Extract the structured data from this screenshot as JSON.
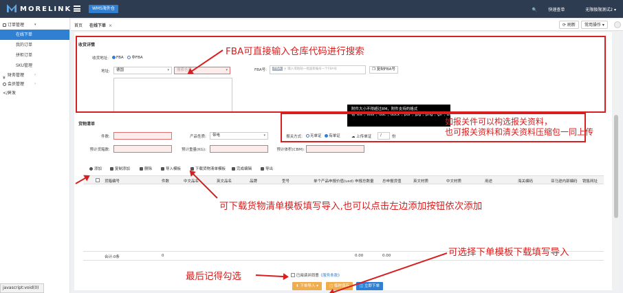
{
  "topbar": {
    "logo": "MORELINK",
    "system_button": "WMS海外仓",
    "quick_search": "快速查单",
    "user": "无限极限测试2"
  },
  "sidebar": {
    "groups": [
      {
        "label": "订单管理",
        "items": [
          "在线下单",
          "我的订单",
          "拼柜订单",
          "SKU管理"
        ]
      },
      {
        "label": "财务管理"
      },
      {
        "label": "会员管理"
      },
      {
        "label": "开发"
      }
    ]
  },
  "tabs": {
    "home": "首页",
    "current": "在线下单",
    "close": "×",
    "refresh": "刷新",
    "common_ops": "常用操作"
  },
  "receiver": {
    "title": "收货详情",
    "addr_type_label": "收货地址:",
    "fba": "FBA",
    "non_fba": "非FBA",
    "address_label": "地址:",
    "country": "德国",
    "warehouse_placeholder": "搜索仓库",
    "fba_no_label": "FBA号:",
    "fba_tag": "FBA",
    "fba_no_placeholder": "输入或粘贴一批国家编号一个FBA号",
    "copy_fba": "复制FBA号"
  },
  "cargo": {
    "title": "货物清单",
    "pieces_label": "件数:",
    "product_type_label": "产品性质:",
    "product_type_value": "带电",
    "declare_label": "报关方式:",
    "declare_opt1": "无单证",
    "declare_opt2": "有单证",
    "upload_label": "上传单证",
    "upload_count": "/",
    "upload_unit": "份",
    "est_boxes_label": "预计货箱数:",
    "est_weight_label": "预计重量(KG):",
    "est_volume_label": "预计体积(CBM):"
  },
  "tooltip": {
    "text": "附件大小不得超过8M，附件支持的格式有\"xls\",\"xlsx\",\"doc\",\"docx\",\"pdf\",\"jpg\",\"png\",\"gif\",\"bmp\",\"jpeg\",\"zip\",\"rar\""
  },
  "toolbar": {
    "add": "添加",
    "copy_add": "复制添加",
    "delete": "删除",
    "import_template": "导入模板",
    "download_template": "下载货物清单模板",
    "finish_edit": "完成编辑",
    "export": "导出"
  },
  "table": {
    "columns": [
      "货箱编号",
      "件数",
      "中文品名",
      "英文品名",
      "品牌",
      "型号",
      "单个产品申报价值(usd)",
      "申报总数量",
      "总申报货值",
      "英文材质",
      "中文材质",
      "用途",
      "海关编码",
      "亚马逊内部编码",
      "销售网址"
    ],
    "footer": {
      "total": "合计:0条",
      "pieces": "0",
      "qty": "0.00",
      "value": "0.00"
    }
  },
  "bottom": {
    "agree": "已阅读并同意",
    "agree_link": "《服务条款》",
    "download_import": "下单导入",
    "temp_save": "临时保存",
    "submit": "立即下单"
  },
  "status_bar": "javascript:void(0)",
  "annotations": {
    "fba_note": "FBA可直接输入仓库代码进行搜索",
    "declare_note_1": "如报关件可以构选报关资料，",
    "declare_note_2": "也可报关资料和清关资料压缩包一同上传",
    "cargo_note": "可下载货物清单模板填写导入,也可以点击左边添加按钮依次添加",
    "order_note": "可选择下单模板下载填写导入",
    "last_note": "最后记得勾选"
  },
  "colors": {
    "accent": "#2f7fd3",
    "annotation": "#d81e1e",
    "topbar": "#2d3c50",
    "orange": "#f0ad4e"
  }
}
